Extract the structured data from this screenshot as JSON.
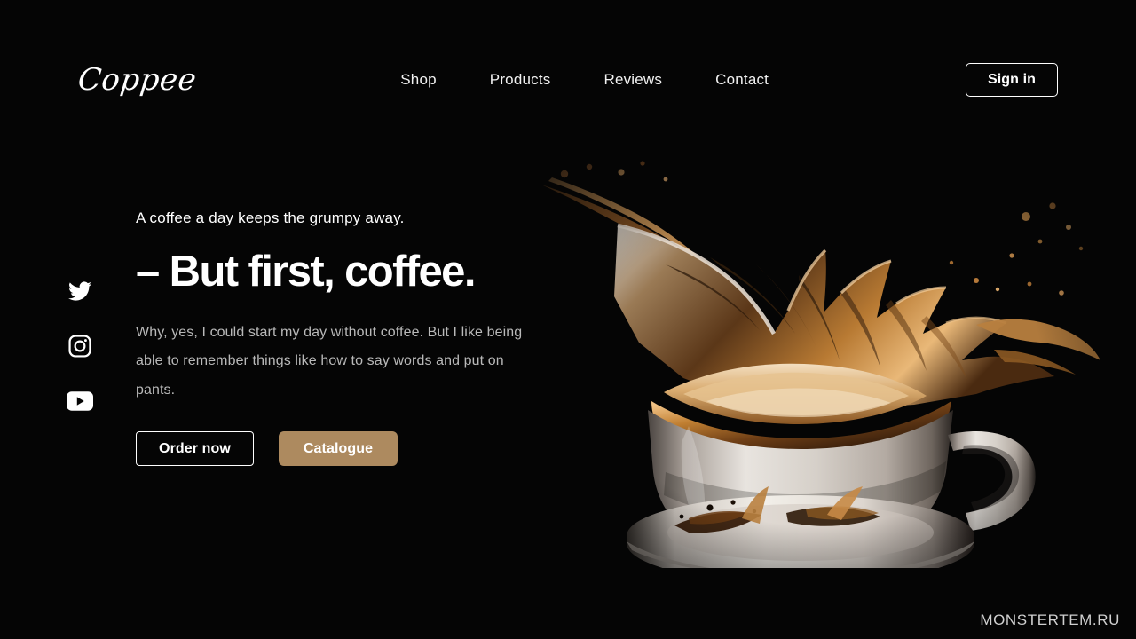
{
  "site": {
    "background_color": "#050505",
    "accent_color": "#ad8a5f",
    "text_color": "#ffffff",
    "muted_text_color": "#b9b9b9"
  },
  "header": {
    "logo": "Coppee",
    "nav": [
      {
        "label": "Shop"
      },
      {
        "label": "Products"
      },
      {
        "label": "Reviews"
      },
      {
        "label": "Contact"
      }
    ],
    "signin_label": "Sign in"
  },
  "social": [
    {
      "name": "twitter-icon",
      "label": "Twitter"
    },
    {
      "name": "instagram-icon",
      "label": "Instagram"
    },
    {
      "name": "youtube-icon",
      "label": "YouTube"
    }
  ],
  "hero": {
    "eyebrow": "A coffee a day keeps the grumpy away.",
    "headline": "– But first, coffee.",
    "body": "Why, yes, I could start my day without coffee. But I like being able to remember things like how to say words and put on pants.",
    "primary_cta": "Order now",
    "secondary_cta": "Catalogue",
    "image_alt": "coffee-cup-splash"
  },
  "watermark": "MONSTERTEM.RU"
}
